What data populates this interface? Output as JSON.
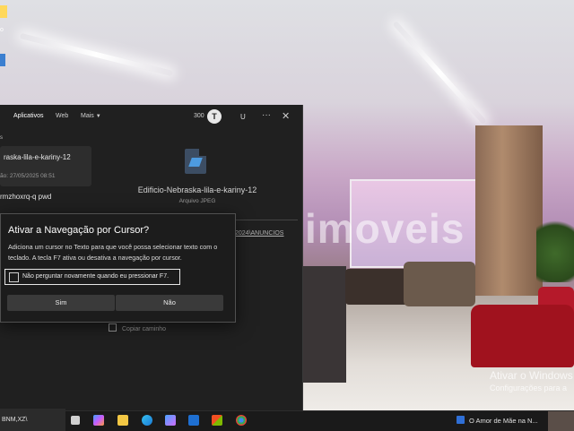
{
  "desktop": {
    "icon_label": "o",
    "watermark": "imoveis",
    "activation_title": "Ativar o Windows",
    "activation_sub": "Configurações para a"
  },
  "app": {
    "nav": [
      "Aplicativos",
      "Web",
      "Mais"
    ],
    "count": "300",
    "avatar_letter": "T",
    "user": "U",
    "more": "···",
    "close": "✕",
    "side_marker": "s",
    "list_item_name": "raska-lila-e-kariny-12",
    "list_item_date": "ão: 27/05/2025 08:51",
    "list_item2": "rmzhoxrq-q pwd",
    "file_title": "Edificio-Nebraska-lila-e-kariny-12",
    "file_type": "Arquivo JPEG",
    "file_path": "2024\\ANUNCIOS",
    "copy_label": "Copiar caminho"
  },
  "dialog": {
    "title": "Ativar a Navegação por Cursor?",
    "body": "Adiciona um cursor no Texto para que você possa selecionar texto com o teclado. A tecla F7 ativa ou desativa a navegação por cursor.",
    "checkbox_label": "Não perguntar novamente quando eu pressionar F7.",
    "checkbox_checked": false,
    "yes": "Sim",
    "no": "Não"
  },
  "taskbar": {
    "search_text": "BNM,XZ\\",
    "media_title": "O Amor de Mãe na N...",
    "apps": [
      "task-view-icon",
      "copilot-icon",
      "file-explorer-icon",
      "edge-icon",
      "copilot-app-icon",
      "outlook-icon",
      "store-icon",
      "chrome-icon"
    ]
  }
}
